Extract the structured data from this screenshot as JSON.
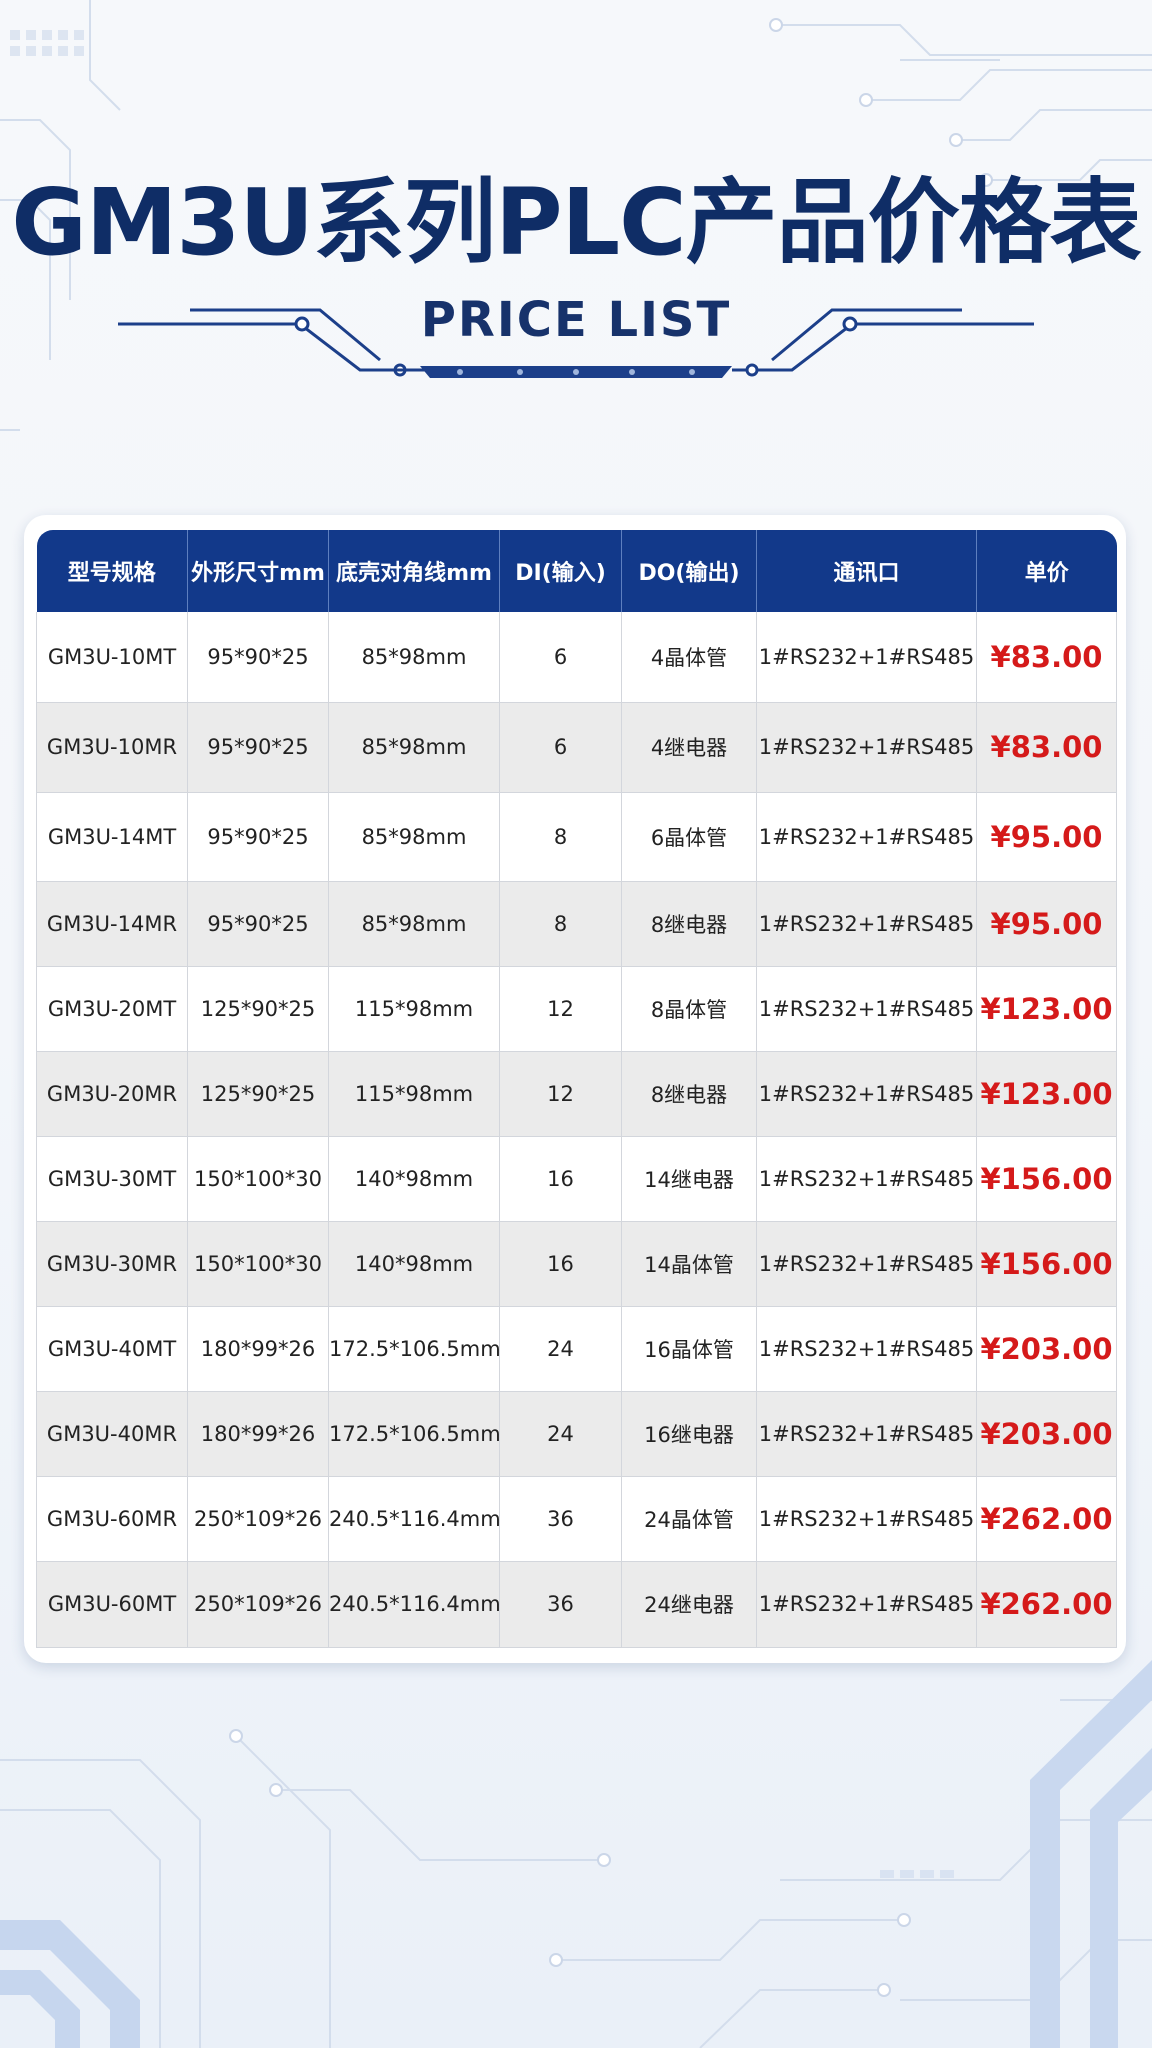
{
  "header": {
    "title": "GM3U系列PLC产品价格表",
    "subtitle": "PRICE LIST"
  },
  "table": {
    "headers": [
      "型号规格",
      "外形尺寸mm",
      "底壳对角线mm",
      "DI(输入)",
      "DO(输出)",
      "通讯口",
      "单价"
    ],
    "rows": [
      [
        "GM3U-10MT",
        "95*90*25",
        "85*98mm",
        "6",
        "4晶体管",
        "1#RS232+1#RS485",
        "¥83.00"
      ],
      [
        "GM3U-10MR",
        "95*90*25",
        "85*98mm",
        "6",
        "4继电器",
        "1#RS232+1#RS485",
        "¥83.00"
      ],
      [
        "GM3U-14MT",
        "95*90*25",
        "85*98mm",
        "8",
        "6晶体管",
        "1#RS232+1#RS485",
        "¥95.00"
      ],
      [
        "GM3U-14MR",
        "95*90*25",
        "85*98mm",
        "8",
        "8继电器",
        "1#RS232+1#RS485",
        "¥95.00"
      ],
      [
        "GM3U-20MT",
        "125*90*25",
        "115*98mm",
        "12",
        "8晶体管",
        "1#RS232+1#RS485",
        "¥123.00"
      ],
      [
        "GM3U-20MR",
        "125*90*25",
        "115*98mm",
        "12",
        "8继电器",
        "1#RS232+1#RS485",
        "¥123.00"
      ],
      [
        "GM3U-30MT",
        "150*100*30",
        "140*98mm",
        "16",
        "14继电器",
        "1#RS232+1#RS485",
        "¥156.00"
      ],
      [
        "GM3U-30MR",
        "150*100*30",
        "140*98mm",
        "16",
        "14晶体管",
        "1#RS232+1#RS485",
        "¥156.00"
      ],
      [
        "GM3U-40MT",
        "180*99*26",
        "172.5*106.5mm",
        "24",
        "16晶体管",
        "1#RS232+1#RS485",
        "¥203.00"
      ],
      [
        "GM3U-40MR",
        "180*99*26",
        "172.5*106.5mm",
        "24",
        "16继电器",
        "1#RS232+1#RS485",
        "¥203.00"
      ],
      [
        "GM3U-60MR",
        "250*109*26",
        "240.5*116.4mm",
        "36",
        "24晶体管",
        "1#RS232+1#RS485",
        "¥262.00"
      ],
      [
        "GM3U-60MT",
        "250*109*26",
        "240.5*116.4mm",
        "36",
        "24继电器",
        "1#RS232+1#RS485",
        "¥262.00"
      ]
    ]
  },
  "colors": {
    "title": "#0f2d66",
    "header_bg": "#12398a",
    "price": "#d51a1a",
    "row_alt": "#ebebeb"
  }
}
